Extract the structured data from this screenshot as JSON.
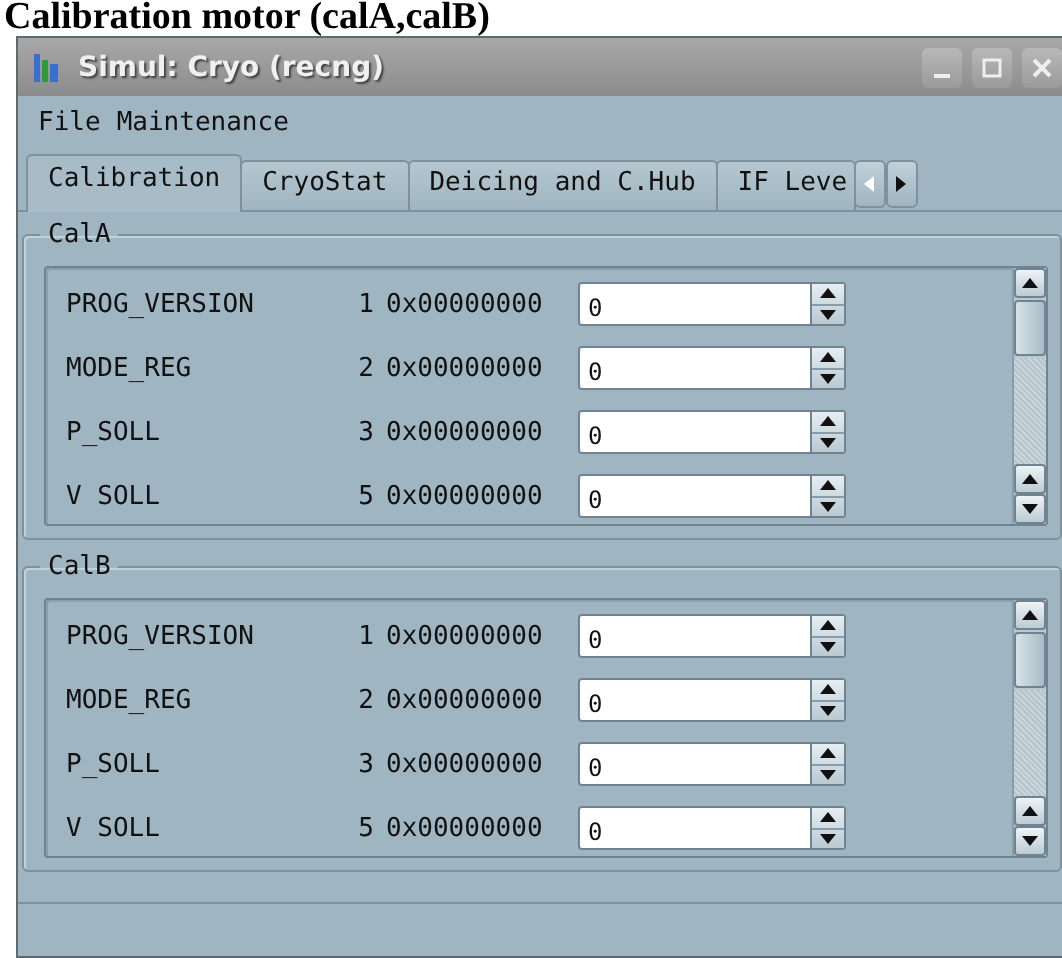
{
  "page_heading": "Calibration motor (calA,calB)",
  "window": {
    "title": "Simul: Cryo (recng)"
  },
  "menu": [
    "File",
    "Maintenance"
  ],
  "tabs": [
    {
      "label": "Calibration",
      "selected": true
    },
    {
      "label": "CryoStat",
      "selected": false
    },
    {
      "label": "Deicing and C.Hub",
      "selected": false
    },
    {
      "label": "IF Leve",
      "selected": false
    }
  ],
  "groups": [
    {
      "title": "CalA",
      "rows": [
        {
          "name": "PROG_VERSION",
          "index": "1",
          "hex": "0x00000000",
          "value": "0"
        },
        {
          "name": "MODE_REG",
          "index": "2",
          "hex": "0x00000000",
          "value": "0"
        },
        {
          "name": "P_SOLL",
          "index": "3",
          "hex": "0x00000000",
          "value": "0"
        },
        {
          "name": "V SOLL",
          "index": "5",
          "hex": "0x00000000",
          "value": "0"
        }
      ]
    },
    {
      "title": "CalB",
      "rows": [
        {
          "name": "PROG_VERSION",
          "index": "1",
          "hex": "0x00000000",
          "value": "0"
        },
        {
          "name": "MODE_REG",
          "index": "2",
          "hex": "0x00000000",
          "value": "0"
        },
        {
          "name": "P_SOLL",
          "index": "3",
          "hex": "0x00000000",
          "value": "0"
        },
        {
          "name": "V SOLL",
          "index": "5",
          "hex": "0x00000000",
          "value": "0"
        }
      ]
    }
  ]
}
